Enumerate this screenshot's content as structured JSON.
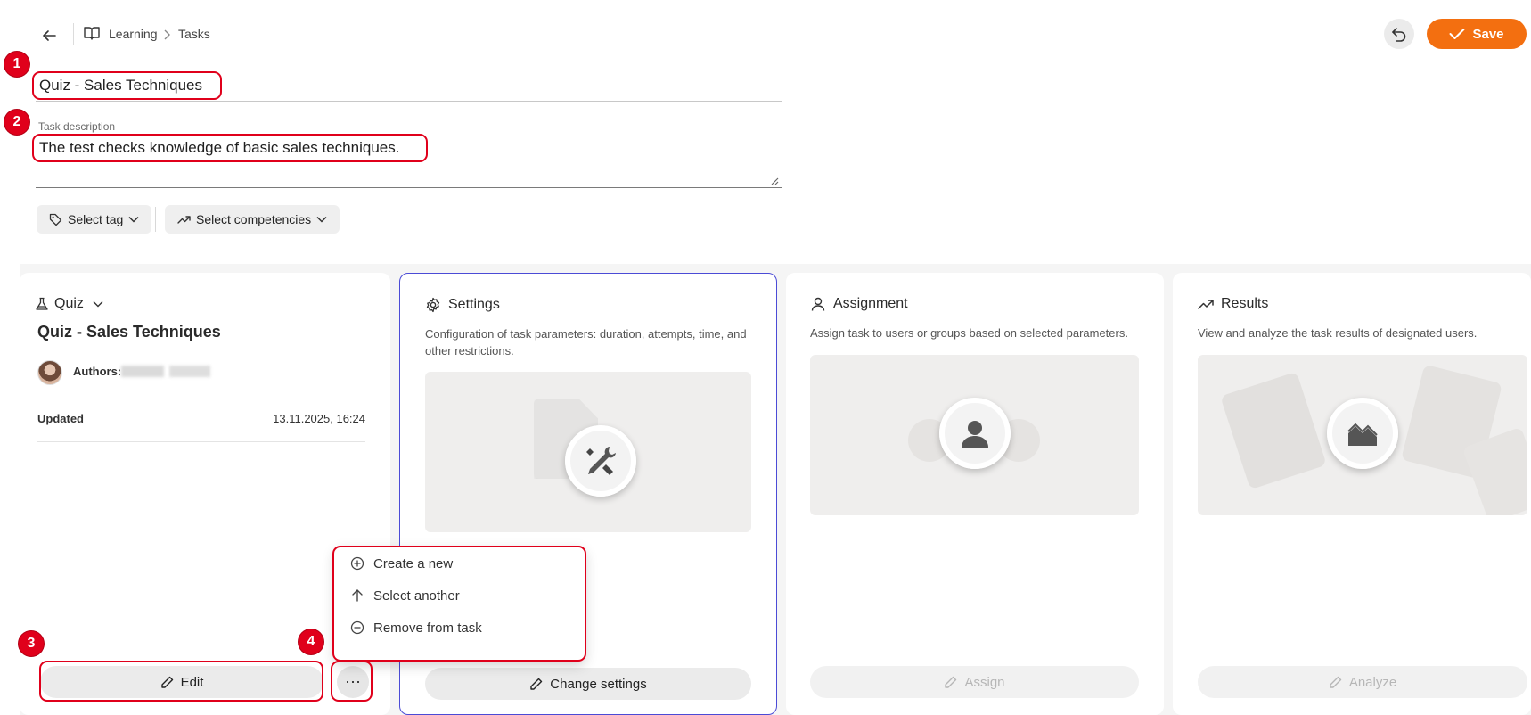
{
  "header": {
    "breadcrumb": [
      "Learning",
      "Tasks"
    ],
    "save_label": "Save"
  },
  "task": {
    "title": "Quiz  - Sales Techniques",
    "description_label": "Task description",
    "description": "The test checks knowledge of basic sales techniques."
  },
  "filters": {
    "tag_label": "Select tag",
    "competencies_label": "Select competencies"
  },
  "quiz_card": {
    "type_label": "Quiz",
    "name": "Quiz - Sales Techniques",
    "authors_label": "Authors:",
    "updated_label": "Updated",
    "updated_value": "13.11.2025, 16:24",
    "edit_label": "Edit",
    "more_label": "⋯"
  },
  "settings_card": {
    "title": "Settings",
    "description": "Configuration of task parameters: duration, attempts, time, and other restrictions.",
    "button_label": "Change settings"
  },
  "assignment_card": {
    "title": "Assignment",
    "description": "Assign task to users or groups based on selected parameters.",
    "button_label": "Assign"
  },
  "results_card": {
    "title": "Results",
    "description": "View and analyze the task results of designated users.",
    "button_label": "Analyze"
  },
  "menu": {
    "items": [
      "Create a new",
      "Select another",
      "Remove from task"
    ]
  },
  "annotations": [
    "1",
    "2",
    "3",
    "4"
  ],
  "colors": {
    "accent": "#f36f10",
    "annotation": "#e0001b",
    "selected_card_border": "#4b4bd6"
  }
}
